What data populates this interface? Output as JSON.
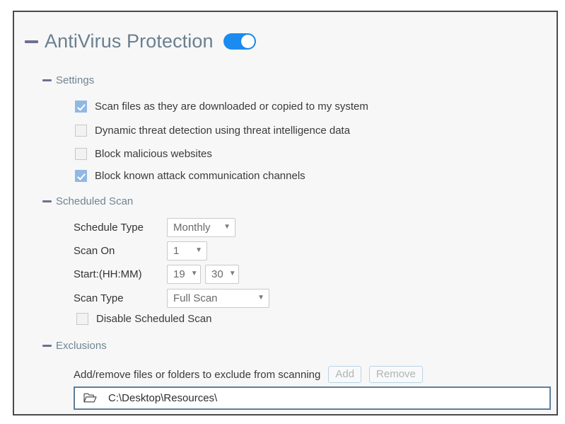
{
  "panel": {
    "title": "AntiVirus Protection",
    "toggle": {
      "name": "antivirus-protection-toggle",
      "state": "on",
      "color": "#1a8cf0"
    }
  },
  "settings": {
    "heading": "Settings",
    "checkboxes": [
      {
        "label": "Scan files as they are downloaded or copied to my system",
        "checked": true
      },
      {
        "label": "Dynamic threat detection using threat intelligence data",
        "checked": false
      },
      {
        "label": "Block malicious websites",
        "checked": false
      },
      {
        "label": "Block known attack communication channels",
        "checked": true
      }
    ]
  },
  "scheduled_scan": {
    "heading": "Scheduled Scan",
    "fields": [
      {
        "label": "Schedule Type",
        "value": "Monthly"
      },
      {
        "label": "Scan On",
        "value": "1"
      },
      {
        "label": "Start:(HH:MM)",
        "hour": "19",
        "minute": "30"
      },
      {
        "label": "Scan Type",
        "value": "Full Scan"
      }
    ],
    "disable_checkbox": {
      "label": "Disable Scheduled Scan",
      "checked": false
    }
  },
  "exclusions": {
    "heading": "Exclusions",
    "description": "Add/remove files or folders to exclude from scanning",
    "add_label": "Add",
    "remove_label": "Remove",
    "path": "C:\\Desktop\\Resources\\",
    "folder_icon": "open-folder-icon"
  },
  "colors": {
    "accent_toggle": "#1a8cf0",
    "checkbox_checked": "#8fb9e3",
    "heading_text": "#6f8593",
    "title_text": "#6b7f90",
    "minus_glyph": "#6f6f93",
    "field_border": "#5d7f9c",
    "panel_border": "#4a4a4a"
  },
  "caret": "▼"
}
